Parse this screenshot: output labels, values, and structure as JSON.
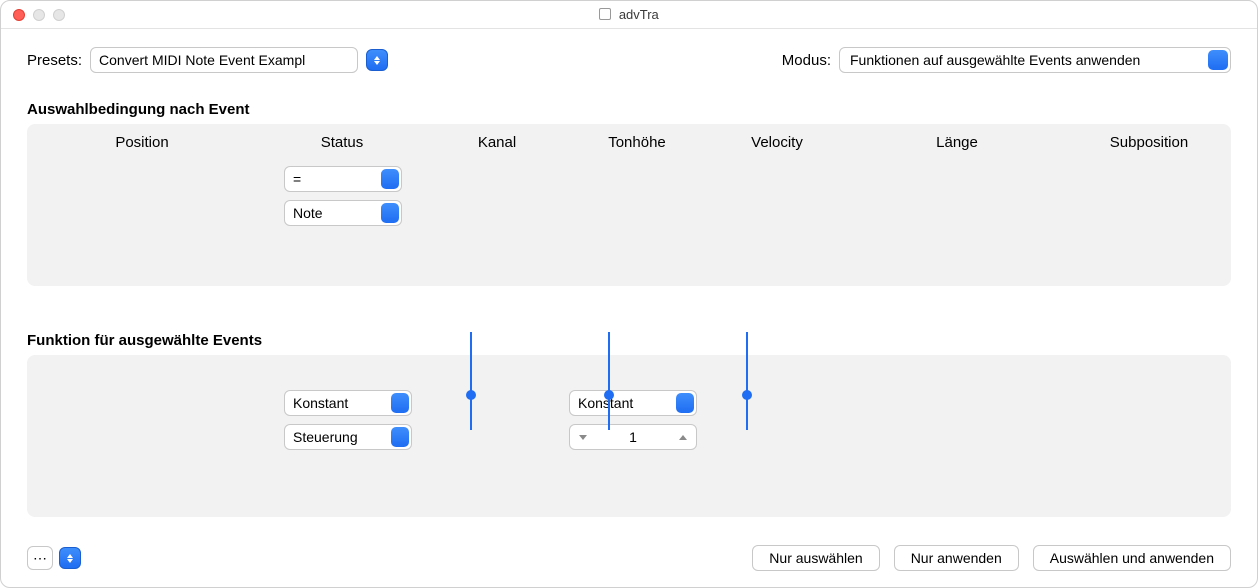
{
  "window": {
    "title": "advTra"
  },
  "top": {
    "presets_label": "Presets:",
    "preset_value": "Convert MIDI Note Event Exampl",
    "modus_label": "Modus:",
    "modus_value": "Funktionen auf ausgewählte Events anwenden"
  },
  "columns": {
    "position": "Position",
    "status": "Status",
    "kanal": "Kanal",
    "tonhoehe": "Tonhöhe",
    "velocity": "Velocity",
    "laenge": "Länge",
    "subposition": "Subposition"
  },
  "section1": {
    "title": "Auswahlbedingung nach Event",
    "status_op": "=",
    "status_val": "Note"
  },
  "section2": {
    "title": "Funktion für ausgewählte Events",
    "status_mode": "Konstant",
    "status_val": "Steuerung",
    "tonhoehe_mode": "Konstant",
    "tonhoehe_val": "1"
  },
  "bottom": {
    "select_only": "Nur auswählen",
    "apply_only": "Nur anwenden",
    "select_and_apply": "Auswählen und anwenden"
  }
}
